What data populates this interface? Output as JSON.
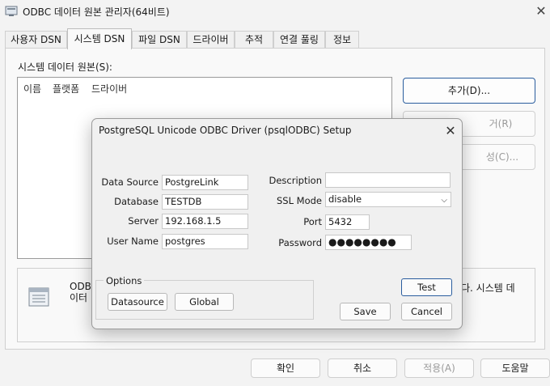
{
  "window": {
    "title": "ODBC 데이터 원본 관리자(64비트)"
  },
  "tabs": [
    {
      "label": "사용자 DSN"
    },
    {
      "label": "시스템 DSN"
    },
    {
      "label": "파일 DSN"
    },
    {
      "label": "드라이버"
    },
    {
      "label": "추적"
    },
    {
      "label": "연결 풀링"
    },
    {
      "label": "정보"
    }
  ],
  "active_tab": "시스템 DSN",
  "system_dsn": {
    "list_label": "시스템 데이터 원본(S):",
    "columns": [
      "이름",
      "플랫폼",
      "드라이버"
    ],
    "buttons": {
      "add": "추가(D)...",
      "remove_partial": "거(R)",
      "configure_partial": "성(C)..."
    },
    "info_left": "ODBC\n이터",
    "info_right": "다. 시스템 데"
  },
  "footer": {
    "ok": "확인",
    "cancel": "취소",
    "apply": "적용(A)",
    "help": "도움말"
  },
  "dialog": {
    "title": "PostgreSQL Unicode ODBC Driver (psqlODBC) Setup",
    "fields": {
      "data_source": {
        "label": "Data Source",
        "value": "PostgreLink"
      },
      "database": {
        "label": "Database",
        "value": "TESTDB"
      },
      "server": {
        "label": "Server",
        "value": "192.168.1.5"
      },
      "user_name": {
        "label": "User Name",
        "value": "postgres"
      },
      "description": {
        "label": "Description",
        "value": ""
      },
      "ssl_mode": {
        "label": "SSL Mode",
        "value": "disable"
      },
      "port": {
        "label": "Port",
        "value": "5432"
      },
      "password": {
        "label": "Password",
        "value": "●●●●●●●●"
      }
    },
    "options": {
      "legend": "Options",
      "datasource": "Datasource",
      "global": "Global"
    },
    "buttons": {
      "test": "Test",
      "save": "Save",
      "cancel": "Cancel"
    }
  },
  "colors": {
    "focus_border": "#2a5d9e",
    "disabled_text": "#9a9a9a"
  }
}
